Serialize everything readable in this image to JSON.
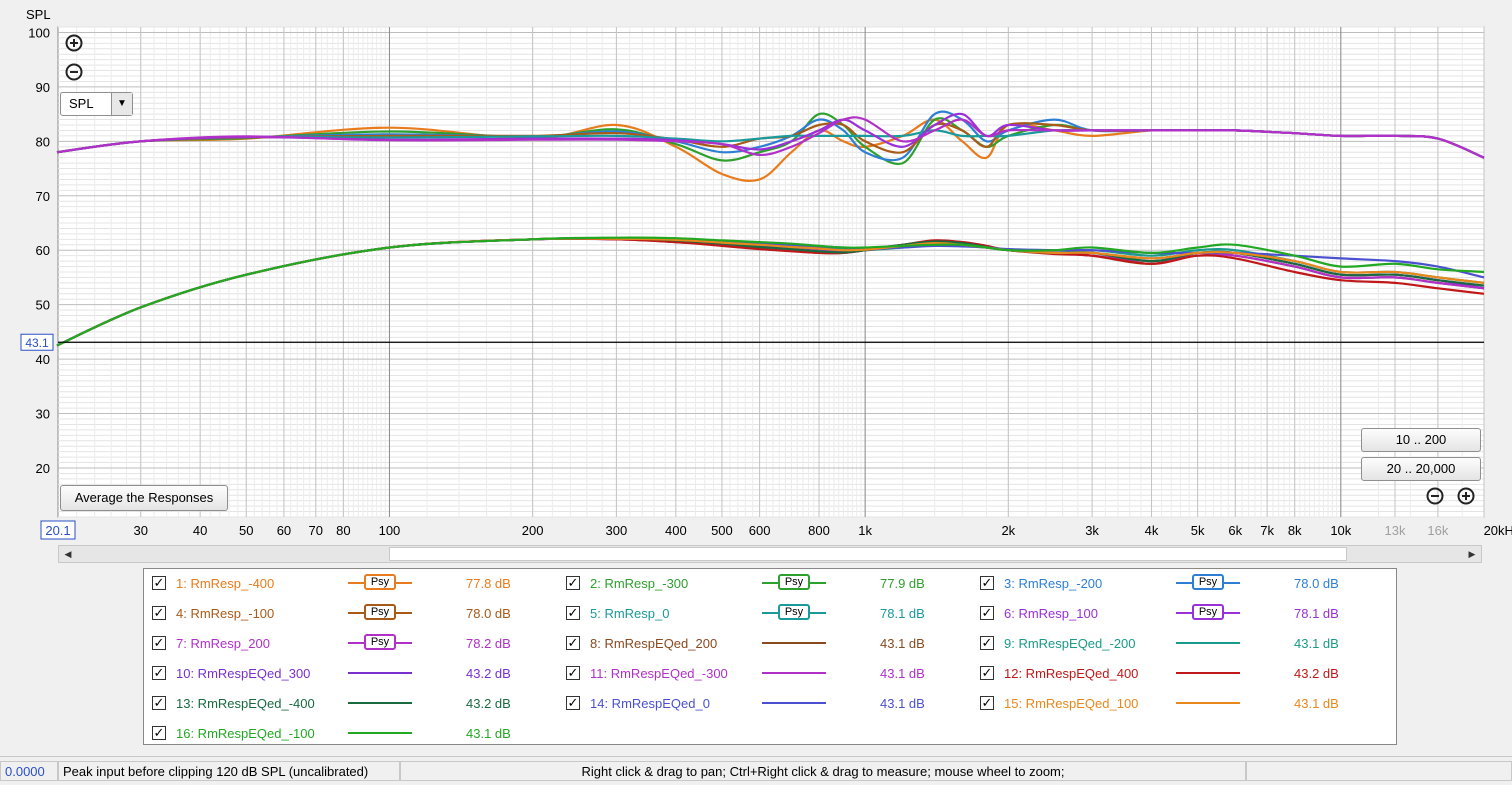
{
  "chart_data": {
    "type": "line",
    "ylabel": "SPL",
    "xlabel_unit": "kHz",
    "xscale": "log",
    "xlim": [
      20.1,
      20000
    ],
    "ylim": [
      11,
      101
    ],
    "y_ticks": [
      20,
      30,
      40,
      50,
      60,
      70,
      80,
      90,
      100
    ],
    "x_ticks": [
      {
        "v": 30,
        "label": "30"
      },
      {
        "v": 40,
        "label": "40"
      },
      {
        "v": 50,
        "label": "50"
      },
      {
        "v": 60,
        "label": "60"
      },
      {
        "v": 70,
        "label": "70"
      },
      {
        "v": 80,
        "label": "80"
      },
      {
        "v": 100,
        "label": "100"
      },
      {
        "v": 200,
        "label": "200"
      },
      {
        "v": 300,
        "label": "300"
      },
      {
        "v": 400,
        "label": "400"
      },
      {
        "v": 500,
        "label": "500"
      },
      {
        "v": 600,
        "label": "600"
      },
      {
        "v": 800,
        "label": "800"
      },
      {
        "v": 1000,
        "label": "1k"
      },
      {
        "v": 2000,
        "label": "2k"
      },
      {
        "v": 3000,
        "label": "3k"
      },
      {
        "v": 4000,
        "label": "4k"
      },
      {
        "v": 5000,
        "label": "5k"
      },
      {
        "v": 6000,
        "label": "6k"
      },
      {
        "v": 7000,
        "label": "7k"
      },
      {
        "v": 8000,
        "label": "8k"
      },
      {
        "v": 10000,
        "label": "10k"
      },
      {
        "v": 13000,
        "label": "13k",
        "faded": true
      },
      {
        "v": 16000,
        "label": "16k",
        "faded": true
      },
      {
        "v": 20000,
        "label": "20kHz"
      }
    ],
    "x_start_label": "20.1",
    "cursor_y": {
      "value": 43.1,
      "label": "43.1"
    },
    "x": [
      20,
      30,
      50,
      100,
      200,
      300,
      400,
      500,
      600,
      700,
      800,
      900,
      1000,
      1200,
      1400,
      1600,
      1800,
      2000,
      2500,
      3000,
      4000,
      5000,
      6000,
      8000,
      10000,
      13000,
      16000,
      20000
    ],
    "series": [
      {
        "name": "1: RmResp_-400",
        "color": "#e87b1c",
        "level": "77.8 dB",
        "psy": true,
        "values": [
          78,
          80,
          80.5,
          82.5,
          80.5,
          83,
          79,
          74,
          73,
          78,
          82,
          80,
          79,
          81,
          84,
          80,
          77,
          83,
          82,
          81,
          82,
          82,
          82,
          81.5,
          81,
          81,
          80.5,
          77
        ]
      },
      {
        "name": "2: RmResp_-300",
        "color": "#2ea02e",
        "level": "77.9 dB",
        "psy": true,
        "values": [
          78,
          80,
          80.6,
          81.8,
          80.8,
          82.2,
          79.5,
          76.5,
          78,
          80,
          85,
          83,
          79,
          76,
          84,
          82,
          79,
          81,
          83,
          82,
          82,
          82,
          82,
          81.5,
          81,
          81,
          80.5,
          77
        ]
      },
      {
        "name": "3: RmResp_-200",
        "color": "#2e7fd4",
        "level": "78.0 dB",
        "psy": true,
        "values": [
          78,
          80,
          80.7,
          81.3,
          80.9,
          81.8,
          80,
          78,
          79,
          81,
          84,
          82,
          78,
          77,
          85,
          84,
          80,
          82,
          84,
          82,
          82,
          82,
          82,
          81.5,
          81,
          81,
          80.5,
          77
        ]
      },
      {
        "name": "4: RmResp_-100",
        "color": "#a85a18",
        "level": "78.0 dB",
        "psy": true,
        "values": [
          78,
          80,
          80.7,
          81,
          81,
          81.5,
          80.3,
          79,
          80.5,
          81,
          83,
          83,
          80,
          78,
          83,
          82,
          79,
          83,
          83,
          82,
          82,
          82,
          82,
          81.5,
          81,
          81,
          80.5,
          77
        ]
      },
      {
        "name": "5: RmResp_0",
        "color": "#1a9a9a",
        "level": "78.1 dB",
        "psy": true,
        "values": [
          78,
          80,
          80.8,
          80.7,
          80.9,
          81,
          80.5,
          80,
          80.5,
          81,
          81,
          81,
          81,
          81,
          82,
          81,
          81,
          81,
          82,
          82,
          82,
          82,
          82,
          81.5,
          81,
          81,
          80.5,
          77
        ]
      },
      {
        "name": "6: RmResp_100",
        "color": "#9a30d8",
        "level": "78.1 dB",
        "psy": true,
        "values": [
          78,
          80,
          80.8,
          80.3,
          80.5,
          80.5,
          80.2,
          79.5,
          78.5,
          80,
          82,
          84,
          82,
          79,
          83,
          85,
          81,
          83,
          82,
          82,
          82,
          82,
          82,
          81.5,
          81,
          81,
          80.5,
          77
        ]
      },
      {
        "name": "7: RmResp_200",
        "color": "#b030c8",
        "level": "78.2 dB",
        "psy": true,
        "values": [
          78,
          80,
          80.9,
          80.2,
          80.3,
          80.3,
          80,
          79.5,
          77.5,
          79,
          81.5,
          84,
          84,
          80,
          82,
          84,
          81,
          82,
          82,
          82,
          82,
          82,
          82,
          81.5,
          81,
          81,
          80.5,
          77
        ]
      },
      {
        "name": "8: RmRespEQed_200",
        "color": "#8a4a20",
        "level": "43.1 dB",
        "psy": false,
        "values": [
          42.5,
          49.5,
          55.5,
          60.5,
          62,
          62,
          61.5,
          61,
          60.5,
          60,
          59.5,
          59.5,
          60,
          61,
          61.5,
          61,
          60.5,
          60,
          59.5,
          59,
          57.5,
          59.5,
          59,
          57,
          55,
          55,
          54,
          53
        ]
      },
      {
        "name": "9: RmRespEQed_-200",
        "color": "#1a9a8a",
        "level": "43.1 dB",
        "psy": false,
        "values": [
          42.5,
          49.5,
          55.5,
          60.5,
          62,
          62.2,
          62,
          61.5,
          61,
          60.8,
          60.5,
          60.2,
          60,
          60.5,
          61,
          61,
          60.5,
          60,
          59.5,
          60,
          59,
          60,
          60,
          58,
          56,
          56,
          55,
          54
        ]
      },
      {
        "name": "10: RmRespEQed_300",
        "color": "#7a30d0",
        "level": "43.2 dB",
        "psy": false,
        "values": [
          42.5,
          49.5,
          55.5,
          60.5,
          62,
          62.1,
          61.8,
          61.2,
          60.8,
          60.5,
          60.2,
          60,
          60.2,
          61,
          61.5,
          61.2,
          60.5,
          60,
          59.5,
          59.5,
          58.5,
          59.5,
          59.5,
          57.5,
          55.5,
          55.5,
          54.5,
          53
        ]
      },
      {
        "name": "11: RmRespEQed_-300",
        "color": "#b030c8",
        "level": "43.1 dB",
        "psy": false,
        "values": [
          42.5,
          49.5,
          55.5,
          60.5,
          62,
          62,
          61.6,
          61,
          60.3,
          60,
          59.8,
          59.8,
          60,
          60.8,
          61.5,
          61.5,
          60.8,
          60,
          59.5,
          59,
          58,
          59,
          59,
          57,
          55,
          55,
          54,
          53
        ]
      },
      {
        "name": "12: RmRespEQed_400",
        "color": "#c01818",
        "level": "43.2 dB",
        "psy": false,
        "values": [
          42.5,
          49.5,
          55.5,
          60.5,
          62,
          62,
          61.5,
          60.8,
          60.2,
          59.8,
          59.5,
          59.5,
          60,
          61,
          61.8,
          61.5,
          60.8,
          60,
          59.3,
          59,
          57.5,
          59,
          58.5,
          56,
          54.5,
          54,
          53,
          52
        ]
      },
      {
        "name": "13: RmRespEQed_-400",
        "color": "#1a6a40",
        "level": "43.2 dB",
        "psy": false,
        "values": [
          42.5,
          49.5,
          55.5,
          60.5,
          62,
          62.2,
          61.8,
          61.2,
          60.6,
          60.2,
          59.8,
          59.6,
          60,
          61,
          61.6,
          61.3,
          60.6,
          60,
          59.5,
          59.5,
          58,
          59.5,
          59.5,
          57.5,
          55.5,
          55.5,
          54.5,
          53.5
        ]
      },
      {
        "name": "14: RmRespEQed_0",
        "color": "#4a50d0",
        "level": "43.1 dB",
        "psy": false,
        "values": [
          42.5,
          49.5,
          55.5,
          60.5,
          62,
          62.2,
          62,
          61.6,
          61.2,
          61,
          60.7,
          60.5,
          60.3,
          60.5,
          60.8,
          60.7,
          60.5,
          60.2,
          60,
          60,
          59.5,
          59.5,
          59.5,
          59,
          58.5,
          58,
          57,
          55
        ]
      },
      {
        "name": "15: RmRespEQed_100",
        "color": "#e8881c",
        "level": "43.1 dB",
        "psy": false,
        "values": [
          42.5,
          49.5,
          55.5,
          60.5,
          62,
          62.1,
          61.9,
          61.4,
          61,
          60.6,
          60.3,
          60,
          60.1,
          60.8,
          61.3,
          61,
          60.5,
          60,
          59.5,
          59.5,
          58.5,
          59.5,
          59.5,
          58,
          56,
          56,
          55,
          54
        ]
      },
      {
        "name": "16: RmRespEQed_-100",
        "color": "#22a822",
        "level": "43.1 dB",
        "psy": false,
        "values": [
          42.5,
          49.5,
          55.5,
          60.5,
          62,
          62.3,
          62.2,
          61.8,
          61.5,
          61.2,
          60.8,
          60.5,
          60.5,
          60.8,
          61,
          61,
          60.5,
          60,
          60,
          60.5,
          59.5,
          60.5,
          61,
          59,
          57,
          57.5,
          56.5,
          56
        ]
      }
    ]
  },
  "controls": {
    "zoom_in_icon": "plus-circle-icon",
    "zoom_out_icon": "minus-circle-icon",
    "spl_select": "SPL",
    "average_button": "Average the Responses",
    "range_10_200": "10 .. 200",
    "range_20_20000": "20 .. 20,000",
    "psy_label": "Psy"
  },
  "statusbar": {
    "value": "0.0000",
    "peak": "Peak input before clipping 120 dB SPL (uncalibrated)",
    "hint": "Right click & drag to pan; Ctrl+Right click & drag to measure; mouse wheel to zoom;"
  }
}
